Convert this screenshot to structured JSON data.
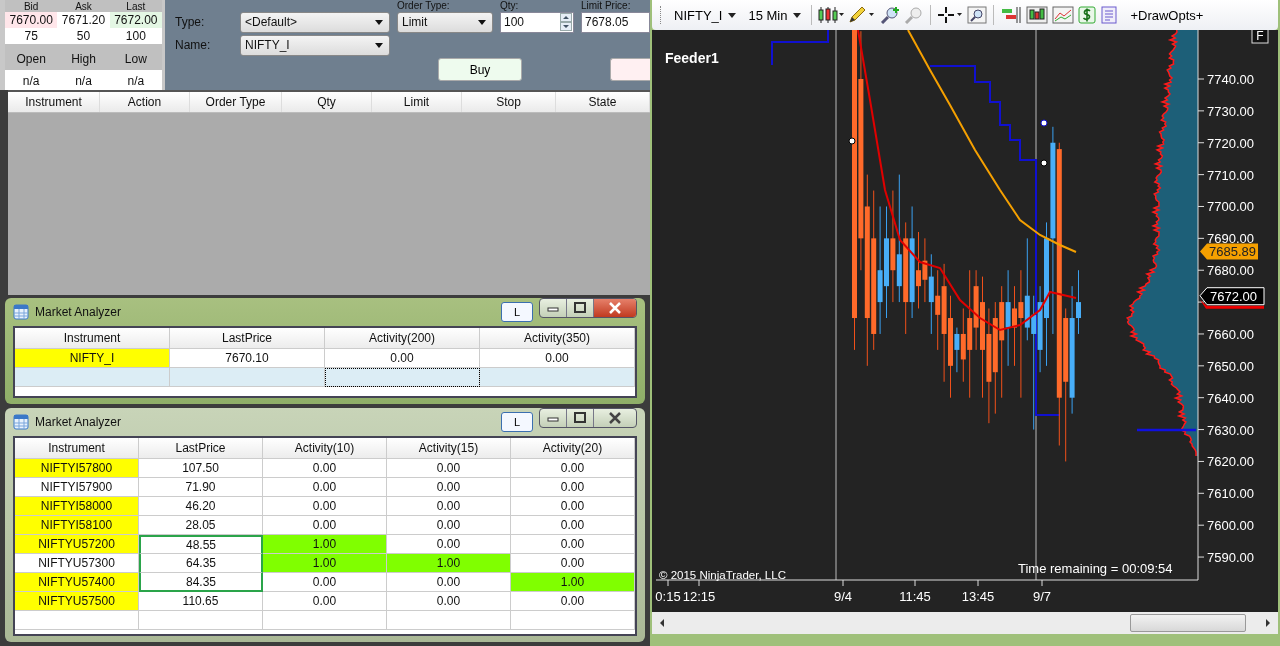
{
  "quote": {
    "headers": [
      "Bid",
      "Ask",
      "Last"
    ],
    "prices": [
      {
        "value": "7670.00",
        "kind": "bid"
      },
      {
        "value": "7671.20",
        "kind": "ask"
      },
      {
        "value": "7672.00",
        "kind": "last"
      }
    ],
    "sizes": [
      "75",
      "50",
      "100"
    ],
    "stat_headers": [
      "Open",
      "High",
      "Low"
    ],
    "stats": [
      "n/a",
      "n/a",
      "n/a"
    ]
  },
  "order_entry": {
    "type_label": "Type:",
    "type_value": "<Default>",
    "name_label": "Name:",
    "name_value": "NIFTY_I",
    "order_type_label": "Order Type:",
    "order_type_value": "Limit",
    "qty_label": "Qty:",
    "qty_value": "100",
    "limit_price_label": "Limit Price:",
    "limit_price_value": "7678.05",
    "buy_button": "Buy"
  },
  "orders_table": {
    "columns": [
      "Instrument",
      "Action",
      "Order Type",
      "Qty",
      "Limit",
      "Stop",
      "State"
    ]
  },
  "analyzers": [
    {
      "title": "Market Analyzer",
      "l_button": "L",
      "active": true,
      "new_row_active": true,
      "columns": [
        "Instrument",
        "LastPrice",
        "Activity(200)",
        "Activity(350)"
      ],
      "rows": [
        {
          "selected": false,
          "cells": [
            {
              "text": "NIFTY_I",
              "color": "#ffff00"
            },
            {
              "text": "7670.10"
            },
            {
              "text": "0.00"
            },
            {
              "text": "0.00"
            }
          ]
        }
      ]
    },
    {
      "title": "Market Analyzer",
      "l_button": "L",
      "active": false,
      "new_row_active": false,
      "columns": [
        "Instrument",
        "LastPrice",
        "Activity(10)",
        "Activity(15)",
        "Activity(20)"
      ],
      "rows": [
        {
          "selected": false,
          "cells": [
            {
              "text": "NIFTYI57800",
              "color": "#ffff00"
            },
            {
              "text": "107.50"
            },
            {
              "text": "0.00"
            },
            {
              "text": "0.00"
            },
            {
              "text": "0.00"
            }
          ]
        },
        {
          "selected": false,
          "cells": [
            {
              "text": "NIFTYI57900"
            },
            {
              "text": "71.90"
            },
            {
              "text": "0.00"
            },
            {
              "text": "0.00"
            },
            {
              "text": "0.00"
            }
          ]
        },
        {
          "selected": false,
          "cells": [
            {
              "text": "NIFTYI58000",
              "color": "#ffff00"
            },
            {
              "text": "46.20"
            },
            {
              "text": "0.00"
            },
            {
              "text": "0.00"
            },
            {
              "text": "0.00"
            }
          ]
        },
        {
          "selected": false,
          "cells": [
            {
              "text": "NIFTYI58100",
              "color": "#ffff00"
            },
            {
              "text": "28.05"
            },
            {
              "text": "0.00"
            },
            {
              "text": "0.00"
            },
            {
              "text": "0.00"
            }
          ]
        },
        {
          "selected": true,
          "cells": [
            {
              "text": "NIFTYU57200",
              "color": "#ffff00"
            },
            {
              "text": "48.55"
            },
            {
              "text": "1.00",
              "color": "#80ff00"
            },
            {
              "text": "0.00"
            },
            {
              "text": "0.00"
            }
          ]
        },
        {
          "selected": true,
          "cells": [
            {
              "text": "NIFTYU57300"
            },
            {
              "text": "64.35"
            },
            {
              "text": "1.00",
              "color": "#80ff00"
            },
            {
              "text": "1.00",
              "color": "#80ff00"
            },
            {
              "text": "0.00"
            }
          ]
        },
        {
          "selected": true,
          "cells": [
            {
              "text": "NIFTYU57400",
              "color": "#ffff00"
            },
            {
              "text": "84.35"
            },
            {
              "text": "0.00"
            },
            {
              "text": "0.00"
            },
            {
              "text": "1.00",
              "color": "#80ff00"
            }
          ]
        },
        {
          "selected": false,
          "cells": [
            {
              "text": "NIFTYU57500",
              "color": "#ffff00"
            },
            {
              "text": "110.65"
            },
            {
              "text": "0.00"
            },
            {
              "text": "0.00"
            },
            {
              "text": "0.00"
            }
          ]
        }
      ]
    }
  ],
  "chart": {
    "instrument": "NIFTY_I",
    "interval": "15 Min",
    "draw_opts": "+DrawOpts+",
    "feeder_label": "Feeder1",
    "f_button": "F",
    "price_labels": [
      "7740.00",
      "7730.00",
      "7720.00",
      "7710.00",
      "7700.00",
      "7690.00",
      "7680.00",
      "7660.00",
      "7650.00",
      "7640.00",
      "7630.00",
      "7620.00",
      "7610.00",
      "7600.00",
      "7590.00"
    ],
    "markers": [
      {
        "value": "7685.89",
        "kind": "ma"
      },
      {
        "value": "7672.00",
        "kind": "last"
      }
    ],
    "time_labels": [
      "0:15",
      "12:15",
      "9/4",
      "11:45",
      "13:45",
      "9/7"
    ],
    "copyright": "© 2015 NinjaTrader, LLC",
    "time_remaining": "Time remaining = 00:09:54"
  }
}
